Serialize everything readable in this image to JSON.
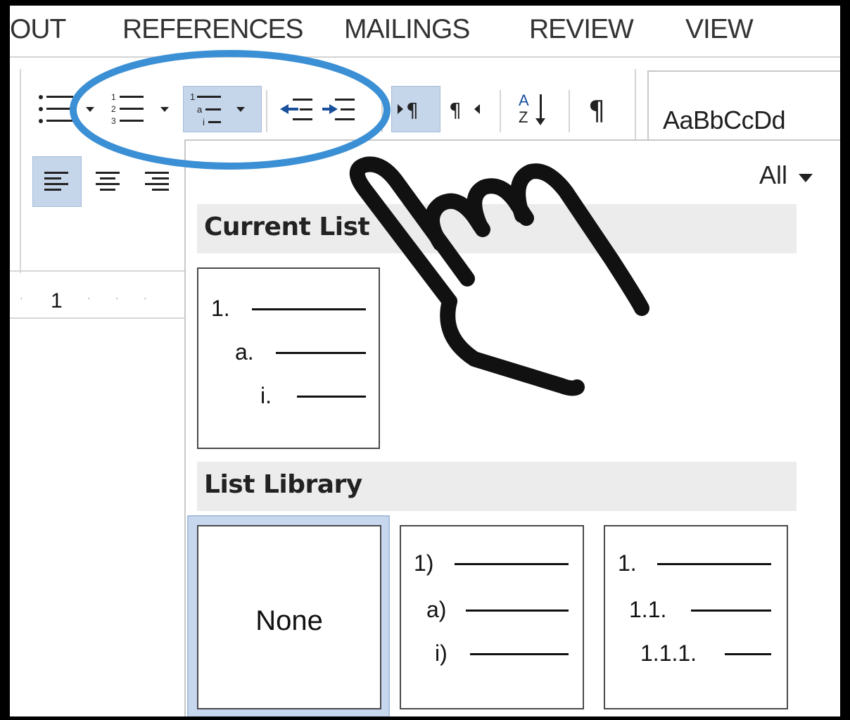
{
  "tabs": [
    "OUT",
    "REFERENCES",
    "MAILINGS",
    "REVIEW",
    "VIEW"
  ],
  "styles": {
    "sample": "AaBbCcDd"
  },
  "ruler": {
    "marker": "1"
  },
  "panel": {
    "filter_label": "All",
    "current_list": {
      "title": "Current List",
      "rows": [
        {
          "marker": "1."
        },
        {
          "marker": "a."
        },
        {
          "marker": "i."
        }
      ]
    },
    "list_library": {
      "title": "List Library",
      "none_label": "None",
      "tile2": [
        {
          "marker": "1)"
        },
        {
          "marker": "a)"
        },
        {
          "marker": "i)"
        }
      ],
      "tile3": [
        {
          "marker": "1."
        },
        {
          "marker": "1.1."
        },
        {
          "marker": "1.1.1."
        }
      ]
    }
  },
  "colors": {
    "highlight": "#c5d5ea",
    "annotation": "#3b8fd4",
    "selected_tile": "#c7d7ee"
  },
  "icons": [
    "bullets-icon",
    "numbering-icon",
    "multilevel-list-icon",
    "decrease-indent-icon",
    "increase-indent-icon",
    "ltr-icon",
    "rtl-icon",
    "sort-icon",
    "pilcrow-icon",
    "align-left-icon",
    "align-center-icon",
    "align-right-icon",
    "pointing-hand-icon"
  ]
}
